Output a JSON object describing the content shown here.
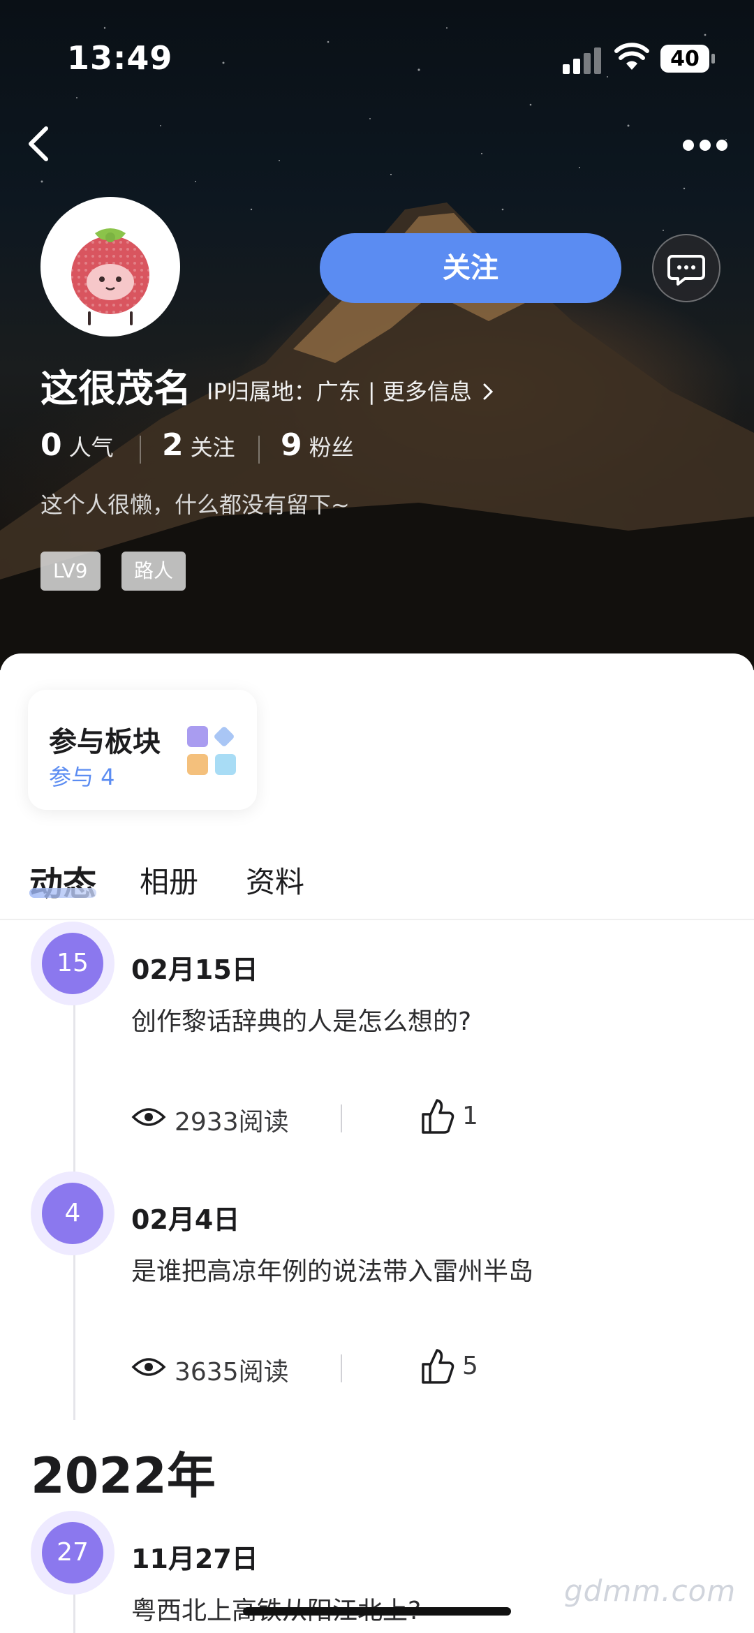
{
  "status_bar": {
    "time": "13:49",
    "battery": "40"
  },
  "profile": {
    "username": "这很茂名",
    "ip_info": "IP归属地：广东 | 更多信息",
    "follow_label": "关注",
    "stats": [
      {
        "value": "0",
        "label": "人气"
      },
      {
        "value": "2",
        "label": "关注"
      },
      {
        "value": "9",
        "label": "粉丝"
      }
    ],
    "bio": "这个人很懒，什么都没有留下~",
    "badges": [
      "LV9",
      "路人"
    ]
  },
  "section_card": {
    "title": "参与板块",
    "subtitle": "参与 4"
  },
  "tabs": [
    "动态",
    "相册",
    "资料"
  ],
  "feed": {
    "posts": [
      {
        "day": "15",
        "date": "02月15日",
        "title": "创作黎话辞典的人是怎么想的?",
        "reads": "2933阅读",
        "likes": "1"
      },
      {
        "day": "4",
        "date": "02月4日",
        "title": "是谁把高凉年例的说法带入雷州半岛",
        "reads": "3635阅读",
        "likes": "5"
      }
    ],
    "year_heading": "2022年",
    "post_2022": {
      "day": "27",
      "date": "11月27日",
      "title": "粤西北上高铁从阳江北上?"
    }
  },
  "watermark": "gdmm.com",
  "colors": {
    "accent": "#5b8cf2",
    "timeline_dot": "#8b78ee"
  }
}
